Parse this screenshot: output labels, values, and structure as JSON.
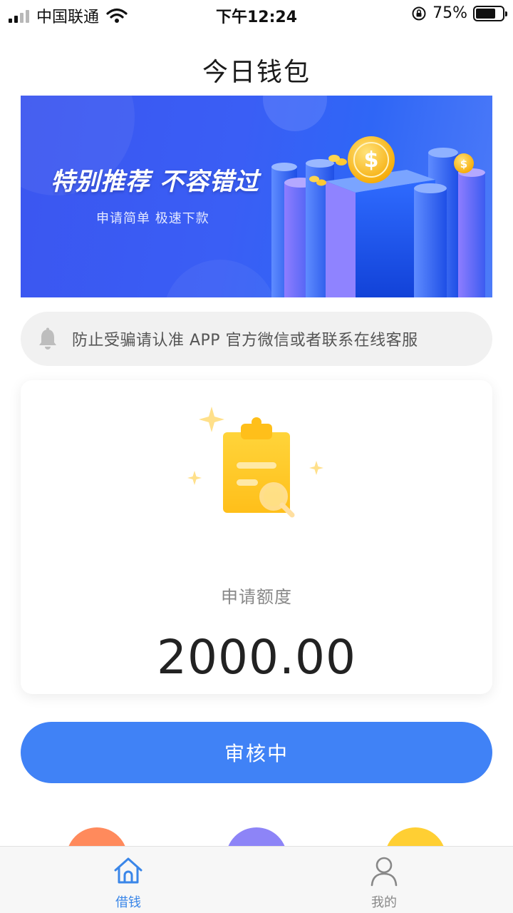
{
  "status_bar": {
    "carrier": "中国联通",
    "time": "下午12:24",
    "battery_percent": "75%",
    "battery_level": 0.75
  },
  "header": {
    "title": "今日钱包"
  },
  "banner": {
    "headline": "特别推荐 不容错过",
    "subtitle": "申请简单 极速下款"
  },
  "notice": {
    "icon": "bell-icon",
    "text": "防止受骗请认准 APP 官方微信或者联系在线客服"
  },
  "card": {
    "icon": "clipboard-search-icon",
    "label": "申请额度",
    "amount": "2000.00"
  },
  "action_button": {
    "label": "审核中"
  },
  "colors": {
    "accent": "#4082f6",
    "banner": "#3b5ef4",
    "notice_bg": "#f1f1f1"
  },
  "tabbar": {
    "items": [
      {
        "label": "借钱",
        "icon": "home-icon",
        "active": true,
        "color": "#3a86e8"
      },
      {
        "label": "我的",
        "icon": "user-icon",
        "active": false,
        "color": "#888888"
      }
    ]
  }
}
